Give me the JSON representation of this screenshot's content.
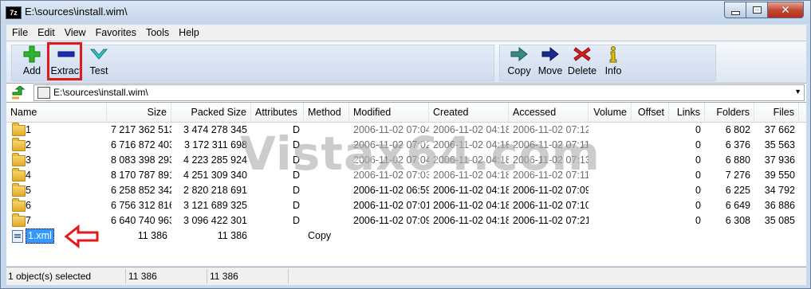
{
  "window": {
    "title": "E:\\sources\\install.wim\\",
    "app_icon_text": "7z"
  },
  "menu": [
    "File",
    "Edit",
    "View",
    "Favorites",
    "Tools",
    "Help"
  ],
  "toolbar": {
    "add": "Add",
    "extract": "Extract",
    "test": "Test",
    "copy": "Copy",
    "move": "Move",
    "delete": "Delete",
    "info": "Info"
  },
  "address": {
    "path": "E:\\sources\\install.wim\\"
  },
  "columns": [
    "Name",
    "Size",
    "Packed Size",
    "Attributes",
    "Method",
    "Modified",
    "Created",
    "Accessed",
    "Volume",
    "Offset",
    "Links",
    "Folders",
    "Files"
  ],
  "rows": [
    {
      "name": "1",
      "size": "7 217 362 513",
      "packed": "3 474 278 345",
      "attr": "D",
      "method": "",
      "modified": "2006-11-02 07:04",
      "created": "2006-11-02 04:18",
      "accessed": "2006-11-02 07:12",
      "links": "0",
      "folders": "6 802",
      "files": "37 662"
    },
    {
      "name": "2",
      "size": "6 716 872 403",
      "packed": "3 172 311 698",
      "attr": "D",
      "method": "",
      "modified": "2006-11-02 07:02",
      "created": "2006-11-02 04:18",
      "accessed": "2006-11-02 07:11",
      "links": "0",
      "folders": "6 376",
      "files": "35 563"
    },
    {
      "name": "3",
      "size": "8 083 398 293",
      "packed": "4 223 285 924",
      "attr": "D",
      "method": "",
      "modified": "2006-11-02 07:04",
      "created": "2006-11-02 04:18",
      "accessed": "2006-11-02 07:13",
      "links": "0",
      "folders": "6 880",
      "files": "37 936"
    },
    {
      "name": "4",
      "size": "8 170 787 891",
      "packed": "4 251 309 340",
      "attr": "D",
      "method": "",
      "modified": "2006-11-02 07:03",
      "created": "2006-11-02 04:18",
      "accessed": "2006-11-02 07:11",
      "links": "0",
      "folders": "7 276",
      "files": "39 550"
    },
    {
      "name": "5",
      "size": "6 258 852 342",
      "packed": "2 820 218 691",
      "attr": "D",
      "method": "",
      "modified": "2006-11-02 06:59",
      "created": "2006-11-02 04:18",
      "accessed": "2006-11-02 07:09",
      "links": "0",
      "folders": "6 225",
      "files": "34 792"
    },
    {
      "name": "6",
      "size": "6 756 312 816",
      "packed": "3 121 689 325",
      "attr": "D",
      "method": "",
      "modified": "2006-11-02 07:01",
      "created": "2006-11-02 04:18",
      "accessed": "2006-11-02 07:10",
      "links": "0",
      "folders": "6 649",
      "files": "36 886"
    },
    {
      "name": "7",
      "size": "6 640 740 963",
      "packed": "3 096 422 301",
      "attr": "D",
      "method": "",
      "modified": "2006-11-02 07:09",
      "created": "2006-11-02 04:18",
      "accessed": "2006-11-02 07:21",
      "links": "0",
      "folders": "6 308",
      "files": "35 085"
    },
    {
      "name": "1.xml",
      "size": "11 386",
      "packed": "11 386",
      "attr": "",
      "method": "Copy",
      "modified": "",
      "created": "",
      "accessed": "",
      "links": "",
      "folders": "",
      "files": "",
      "selected": true
    }
  ],
  "watermark": "Vistax64.com",
  "status": {
    "selected": "1 object(s) selected",
    "size": "11 386",
    "packed": "11 386"
  },
  "colors": {
    "highlight": "#e01a1a",
    "selection": "#3399ff"
  }
}
